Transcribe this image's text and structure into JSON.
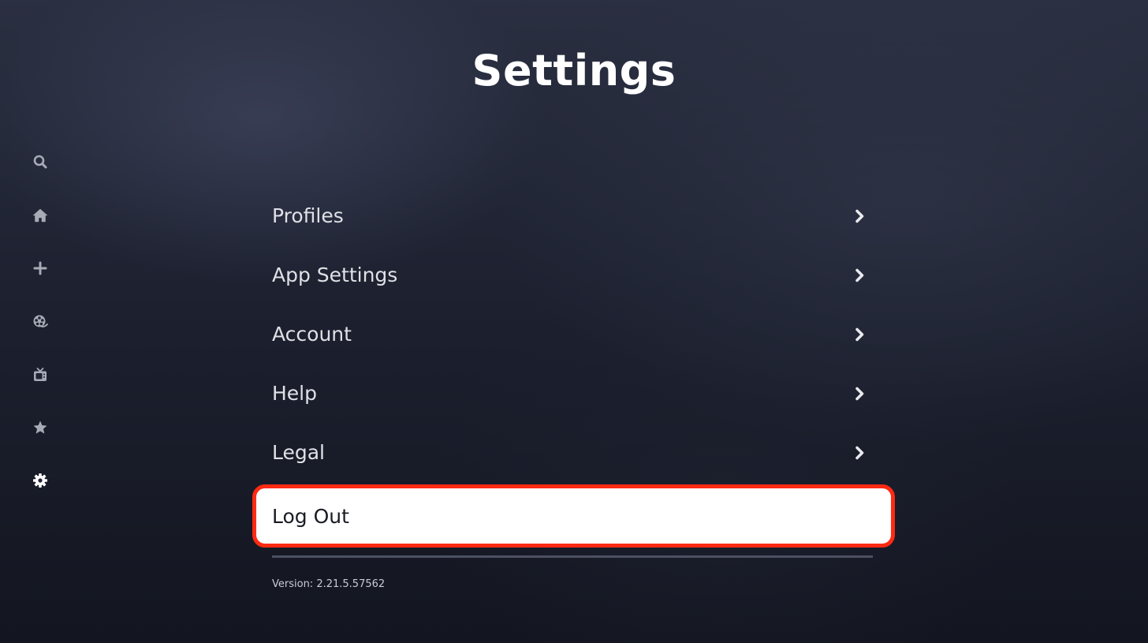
{
  "page": {
    "title": "Settings",
    "version_text": "Version: 2.21.5.57562"
  },
  "sidebar": {
    "items": [
      {
        "icon": "search-icon",
        "active": false
      },
      {
        "icon": "home-icon",
        "active": false
      },
      {
        "icon": "plus-icon",
        "active": false
      },
      {
        "icon": "film-reel-icon",
        "active": false
      },
      {
        "icon": "tv-icon",
        "active": false
      },
      {
        "icon": "star-icon",
        "active": false
      },
      {
        "icon": "gear-icon",
        "active": true
      }
    ]
  },
  "menu": {
    "items": [
      {
        "label": "Profiles",
        "has_chevron": true
      },
      {
        "label": "App Settings",
        "has_chevron": true
      },
      {
        "label": "Account",
        "has_chevron": true
      },
      {
        "label": "Help",
        "has_chevron": true
      },
      {
        "label": "Legal",
        "has_chevron": true
      },
      {
        "label": "Log Out",
        "has_chevron": false,
        "focused": true
      }
    ]
  },
  "colors": {
    "focus_border": "#ff2a12",
    "focus_fill": "#ffffff",
    "background_top": "#2a2f41",
    "background_bottom": "#131620"
  }
}
